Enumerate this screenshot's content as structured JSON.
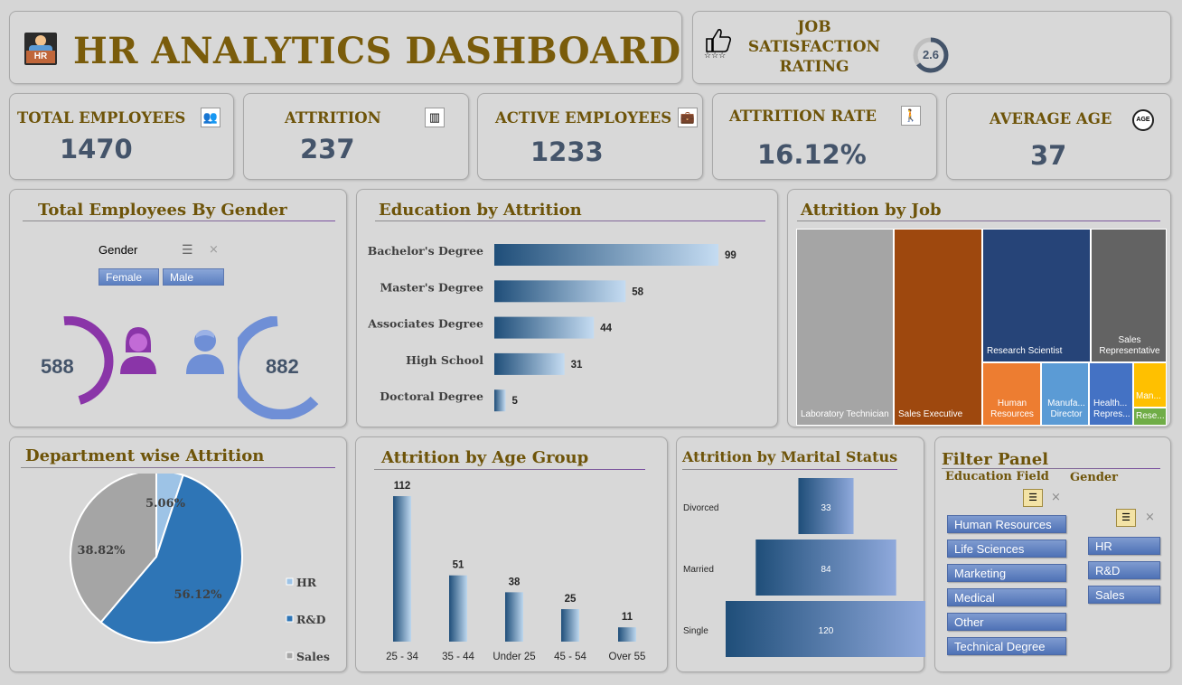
{
  "header": {
    "title": "HR ANALYTICS DASHBOARD",
    "icon_label": "HR"
  },
  "job_satisfaction": {
    "title_line1": "JOB",
    "title_line2": "SATISFACTION",
    "title_line3": "RATING",
    "value": "2.6",
    "ring_fraction": 0.65
  },
  "kpis": {
    "total_employees": {
      "label": "TOTAL EMPLOYEES",
      "value": "1470"
    },
    "attrition": {
      "label": "ATTRITION",
      "value": "237"
    },
    "active_employees": {
      "label": "ACTIVE EMPLOYEES",
      "value": "1233"
    },
    "attrition_rate": {
      "label": "ATTRITION RATE",
      "value": "16.12%"
    },
    "average_age": {
      "label": "AVERAGE AGE",
      "value": "37",
      "icon_text": "AGE"
    }
  },
  "gender_panel": {
    "title": "Total Employees By Gender",
    "slicer_label": "Gender",
    "buttons": [
      "Female",
      "Male"
    ],
    "female_value": "588",
    "male_value": "882",
    "female_color": "#8a35a8",
    "male_color": "#6f8fd6"
  },
  "colors": {
    "title_gold": "#6e5409",
    "kpi_value": "#44546a",
    "bar_dark": "#1f4e79",
    "bar_light": "#bdd7ee",
    "slicer_blue": "#5a7ec0"
  },
  "chart_data": [
    {
      "id": "education",
      "type": "bar",
      "orientation": "horizontal",
      "title": "Education by Attrition",
      "categories": [
        "Bachelor's Degree",
        "Master's Degree",
        "Associates Degree",
        "High School",
        "Doctoral Degree"
      ],
      "values": [
        99,
        58,
        44,
        31,
        5
      ]
    },
    {
      "id": "job",
      "type": "treemap",
      "title": "Attrition by Job",
      "items": [
        {
          "label": "Laboratory Technician",
          "color": "#a5a5a5"
        },
        {
          "label": "Sales Executive",
          "color": "#9e480e"
        },
        {
          "label": "Research Scientist",
          "color": "#264478"
        },
        {
          "label": "Sales Representative",
          "color": "#636363"
        },
        {
          "label": "Human Resources",
          "color": "#ed7d31"
        },
        {
          "label": "Manufa... Director",
          "color": "#5b9bd5"
        },
        {
          "label": "Health... Repres...",
          "color": "#4472c4"
        },
        {
          "label": "Man...",
          "color": "#ffc000"
        },
        {
          "label": "Rese...",
          "color": "#70ad47"
        }
      ]
    },
    {
      "id": "department",
      "type": "pie",
      "title": "Department wise Attrition",
      "categories": [
        "HR",
        "R&D",
        "Sales"
      ],
      "values": [
        5.06,
        56.12,
        38.82
      ],
      "labels": [
        "5.06%",
        "56.12%",
        "38.82%"
      ],
      "colors": [
        "#9dc3e6",
        "#2e75b6",
        "#a5a5a5"
      ],
      "legend": "right"
    },
    {
      "id": "age",
      "type": "bar",
      "title": "Attrition by Age Group",
      "categories": [
        "25 - 34",
        "35 - 44",
        "Under 25",
        "45 - 54",
        "Over 55"
      ],
      "values": [
        112,
        51,
        38,
        25,
        11
      ]
    },
    {
      "id": "marital",
      "type": "bar",
      "orientation": "horizontal-centered",
      "title": "Attrition by Marital Status",
      "categories": [
        "Divorced",
        "Married",
        "Single"
      ],
      "values": [
        33,
        84,
        120
      ]
    }
  ],
  "filter_panel": {
    "title": "Filter Panel",
    "education_field_label": "Education Field",
    "gender_label": "Gender",
    "education_fields": [
      "Human Resources",
      "Life Sciences",
      "Marketing",
      "Medical",
      "Other",
      "Technical Degree"
    ],
    "departments": [
      "HR",
      "R&D",
      "Sales"
    ]
  }
}
